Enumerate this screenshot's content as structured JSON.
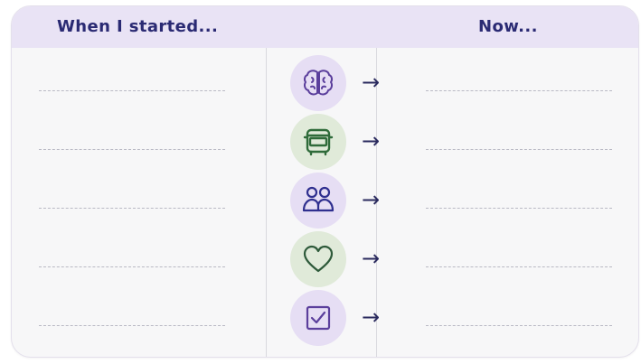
{
  "header": {
    "left_title": "When I started...",
    "right_title": "Now..."
  },
  "rows": [
    {
      "icon": "brain-icon",
      "arrow": "→",
      "accent": "#e6def4"
    },
    {
      "icon": "bus-icon",
      "arrow": "→",
      "accent": "#e0ead9"
    },
    {
      "icon": "people-icon",
      "arrow": "→",
      "accent": "#e6def4"
    },
    {
      "icon": "heart-icon",
      "arrow": "→",
      "accent": "#e0ead9"
    },
    {
      "icon": "checkbox-icon",
      "arrow": "→",
      "accent": "#e6def4"
    }
  ],
  "colors": {
    "header_bg": "#e9e3f5",
    "title_text": "#2a2a73",
    "purple_icon": "#5b3f9c",
    "green_icon": "#2f6b3a"
  }
}
